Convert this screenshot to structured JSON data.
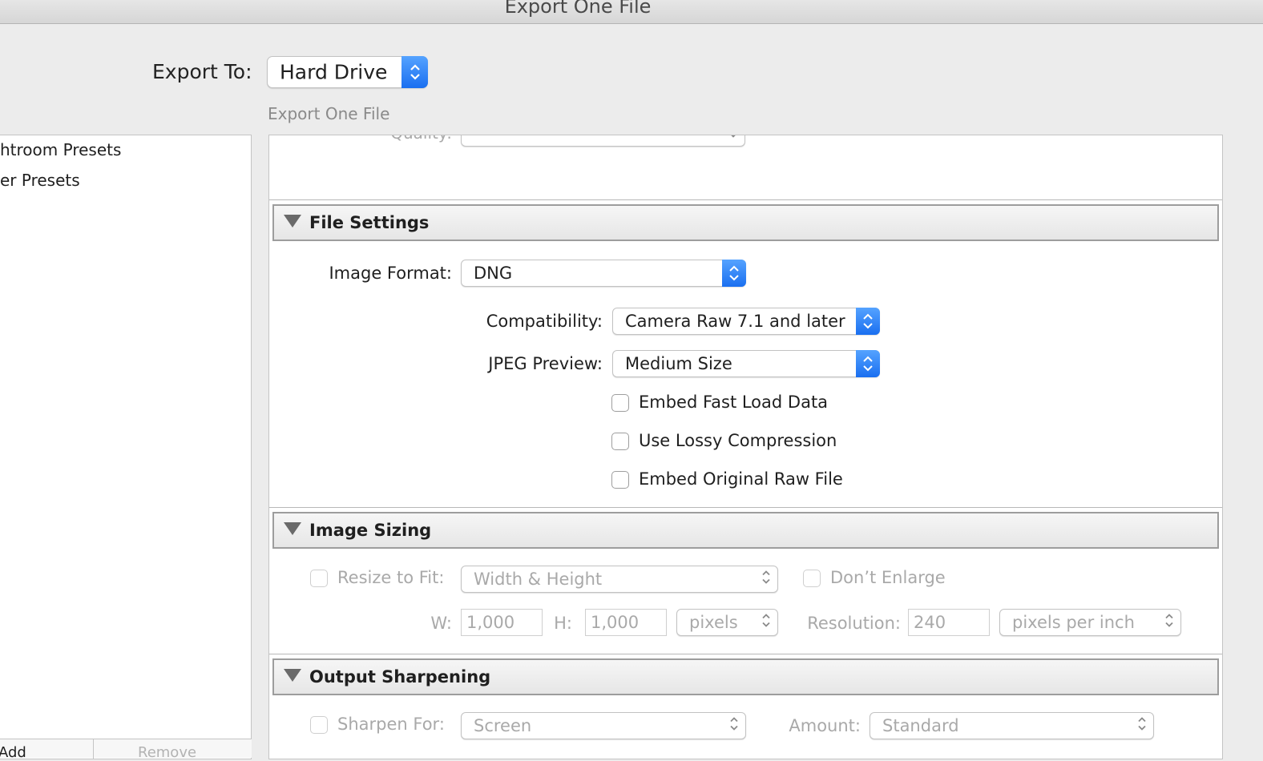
{
  "window": {
    "title": "Export One File"
  },
  "export_to": {
    "label": "Export To:",
    "value": "Hard Drive"
  },
  "section_label": "Export One File",
  "presets": {
    "items": [
      "htroom Presets",
      "er Presets"
    ],
    "add_label": "Add",
    "remove_label": "Remove"
  },
  "quality_row": {
    "label": "Quality:"
  },
  "file_settings": {
    "title": "File Settings",
    "image_format_label": "Image Format:",
    "image_format_value": "DNG",
    "compatibility_label": "Compatibility:",
    "compatibility_value": "Camera Raw 7.1 and later",
    "jpeg_preview_label": "JPEG Preview:",
    "jpeg_preview_value": "Medium Size",
    "checkboxes": [
      "Embed Fast Load Data",
      "Use Lossy Compression",
      "Embed Original Raw File"
    ]
  },
  "image_sizing": {
    "title": "Image Sizing",
    "resize_label": "Resize to Fit:",
    "resize_value": "Width & Height",
    "dont_enlarge_label": "Don’t Enlarge",
    "w_label": "W:",
    "w_value": "1,000",
    "h_label": "H:",
    "h_value": "1,000",
    "units_value": "pixels",
    "resolution_label": "Resolution:",
    "resolution_value": "240",
    "resolution_units_value": "pixels per inch"
  },
  "output_sharpening": {
    "title": "Output Sharpening",
    "sharpen_for_label": "Sharpen For:",
    "sharpen_for_value": "Screen",
    "amount_label": "Amount:",
    "amount_value": "Standard"
  },
  "colors": {
    "accent": "#1a6ff0",
    "disabled_text": "#a9a9a9"
  }
}
